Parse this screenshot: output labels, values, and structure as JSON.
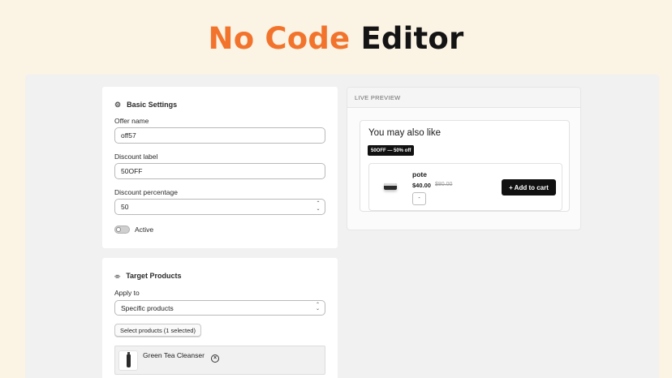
{
  "headline": {
    "accent": "No Code",
    "rest": "Editor"
  },
  "basic_settings": {
    "title": "Basic Settings",
    "offer_name_label": "Offer name",
    "offer_name_value": "off57",
    "discount_label_label": "Discount label",
    "discount_label_value": "50OFF",
    "discount_percentage_label": "Discount percentage",
    "discount_percentage_value": "50",
    "stepper_up": "⌃",
    "stepper_down": "⌄",
    "active_label": "Active",
    "active_on": false
  },
  "target_products": {
    "title": "Target Products",
    "apply_to_label": "Apply to",
    "apply_to_value": "Specific products",
    "select_button": "Select products (1 selected)",
    "selected": [
      {
        "name": "Green Tea Cleanser"
      }
    ]
  },
  "preview": {
    "header": "LIVE PREVIEW",
    "widget_title": "You may also like",
    "badge": "50OFF — 50% off",
    "product": {
      "name": "pote",
      "price": "$40.00",
      "compare_price": "$80.00",
      "quantity": "-",
      "add_button": "+ Add to cart"
    }
  },
  "colors": {
    "accent": "#f2742c",
    "background": "#fbf3e4",
    "workspace": "#f1f1f1"
  },
  "icons": {
    "basic_settings": "gear-icon",
    "target_products": "tag-icon",
    "remove": "remove-circle-icon"
  }
}
